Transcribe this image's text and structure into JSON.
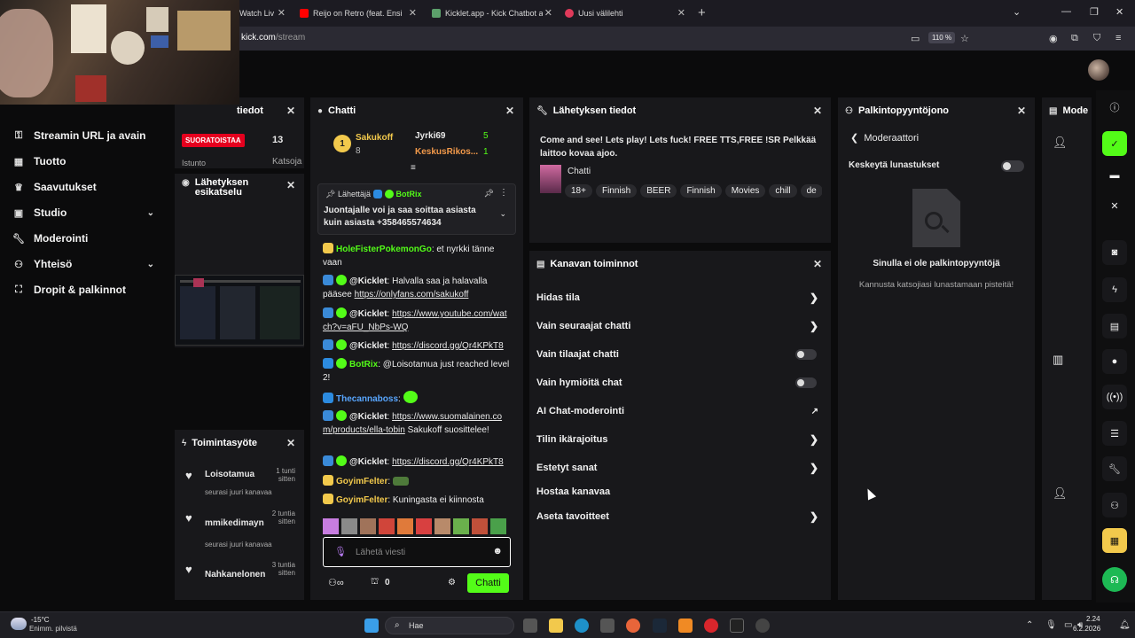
{
  "browser": {
    "tabs": [
      {
        "label": "Watch Liv",
        "color": "#53fc18"
      },
      {
        "label": "Reijo on Retro (feat. Ensio Soik",
        "color": "#ff0000"
      },
      {
        "label": "Kicklet.app - Kick Chatbot and C",
        "color": "#5ca06b"
      },
      {
        "label": "Uusi välilehti",
        "color": "#e03a5a"
      }
    ],
    "url_host": "kick.com",
    "url_path": "/stream",
    "zoom": "110 %"
  },
  "sidebar": {
    "items": [
      {
        "label": "Streamin URL ja avain",
        "icon": "key-icon"
      },
      {
        "label": "Tuotto",
        "icon": "chart-icon"
      },
      {
        "label": "Saavutukset",
        "icon": "trophy-icon"
      },
      {
        "label": "Studio",
        "icon": "studio-icon"
      },
      {
        "label": "Moderointi",
        "icon": "wrench-icon"
      },
      {
        "label": "Yhteisö",
        "icon": "people-icon"
      },
      {
        "label": "Dropit & palkinnot",
        "icon": "gift-icon"
      }
    ]
  },
  "stream_info_panel": {
    "title": "tiedot",
    "live_badge": "SUORATOISTAA",
    "viewers": "13",
    "label_left": "Istunto",
    "label_right": "Katsoja"
  },
  "preview_panel": {
    "title": "Lähetyksen esikatselu"
  },
  "activity_panel": {
    "title": "Toimintasyöte",
    "items": [
      {
        "name": "Loisotamua",
        "time": "1 tunti sitten",
        "event": "seurasi juuri kanavaa"
      },
      {
        "name": "mmikedimayn",
        "time": "2 tuntia sitten",
        "event": "seurasi juuri kanavaa"
      },
      {
        "name": "Nahkanelonen",
        "time": "3 tuntia sitten",
        "event": ""
      }
    ]
  },
  "chat": {
    "title": "Chatti",
    "leaderboard": [
      {
        "rank": "1",
        "name": "Sakukoff",
        "count": "8"
      },
      {
        "name": "Jyrki69",
        "count": "5"
      },
      {
        "name": "KeskusRikos...",
        "count": "1"
      }
    ],
    "pinned": {
      "author_label": "Lähettäjä",
      "author": "BotRix",
      "text": "Juontajalle voi ja saa soittaa asiasta kuin asiasta +358465574634"
    },
    "messages": [
      {
        "user": "HoleFisterPokemonGo",
        "color": "#53fc18",
        "text": "et nyrkki tänne vaan",
        "link": ""
      },
      {
        "user": "@Kicklet",
        "color": "#ffffff",
        "text": "Halvalla saa ja halavalla pääsee",
        "link": "https://onlyfans.com/sakukoff"
      },
      {
        "user": "@Kicklet",
        "color": "#ffffff",
        "text": "",
        "link": "https://www.youtube.com/watch?v=aFU_NbPs-WQ"
      },
      {
        "user": "@Kicklet",
        "color": "#ffffff",
        "text": "",
        "link": "https://discord.gg/Qr4KPkT8"
      },
      {
        "user": "BotRix",
        "color": "#53fc18",
        "text": "@Loisotamua just reached level 2!",
        "link": ""
      },
      {
        "user": "Thecannaboss",
        "color": "#58a6ff",
        "text": "",
        "link": ""
      },
      {
        "user": "@Kicklet",
        "color": "#ffffff",
        "text": "Sakukoff suosittelee!",
        "link": "https://www.suomalainen.com/products/ella-tobin"
      },
      {
        "user": "@Kicklet",
        "color": "#ffffff",
        "text": "",
        "link": "https://discord.gg/Qr4KPkT8"
      },
      {
        "user": "GoyimFelter",
        "color": "#f2c94c",
        "text": "",
        "link": ""
      },
      {
        "user": "GoyimFelter",
        "color": "#f2c94c",
        "text": "Kuningasta ei kiinnosta",
        "link": ""
      }
    ],
    "input_placeholder": "Lähetä viesti",
    "points": "0",
    "send_label": "Chatti"
  },
  "broadcast_panel": {
    "title": "Lähetyksen tiedot",
    "stream_title": "Come and see! Lets play! Lets fuck! FREE TTS,FREE !SR Pelkkää laittoo kovaa ajoo.",
    "category": "Chatti",
    "tags": [
      "18+",
      "Finnish",
      "BEER",
      "Finnish",
      "Movies",
      "chill",
      "de"
    ]
  },
  "channel_actions": {
    "title": "Kanavan toiminnot",
    "rows": [
      {
        "label": "Hidas tila",
        "control": "chevron"
      },
      {
        "label": "Vain seuraajat chatti",
        "control": "chevron"
      },
      {
        "label": "Vain tilaajat chatti",
        "control": "toggle"
      },
      {
        "label": "Vain hymiöitä chat",
        "control": "toggle"
      },
      {
        "label": "AI Chat-moderointi",
        "control": "external"
      },
      {
        "label": "Tilin ikärajoitus",
        "control": "chevron"
      },
      {
        "label": "Estetyt sanat",
        "control": "chevron"
      },
      {
        "label": "Hostaa kanavaa",
        "control": "none"
      },
      {
        "label": "Aseta tavoitteet",
        "control": "chevron"
      }
    ]
  },
  "rewards_panel": {
    "title": "Palkintopyyntöjono",
    "back_label": "Moderaattori",
    "pause_label": "Keskeytä lunastukset",
    "empty_title": "Sinulla ei ole palkintopyyntöjä",
    "empty_sub": "Kannusta katsojiasi lunastamaan pisteitä!"
  },
  "mod_panel": {
    "title": "Mode"
  },
  "taskbar": {
    "weather_temp": "-15°C",
    "weather_desc": "Enimm. pilvistä",
    "search": "Hae",
    "time": "2.24",
    "date": "6.2.2026"
  },
  "colors": {
    "accent": "#53fc18",
    "panel": "#18181b",
    "bg": "#0b0b0c"
  }
}
